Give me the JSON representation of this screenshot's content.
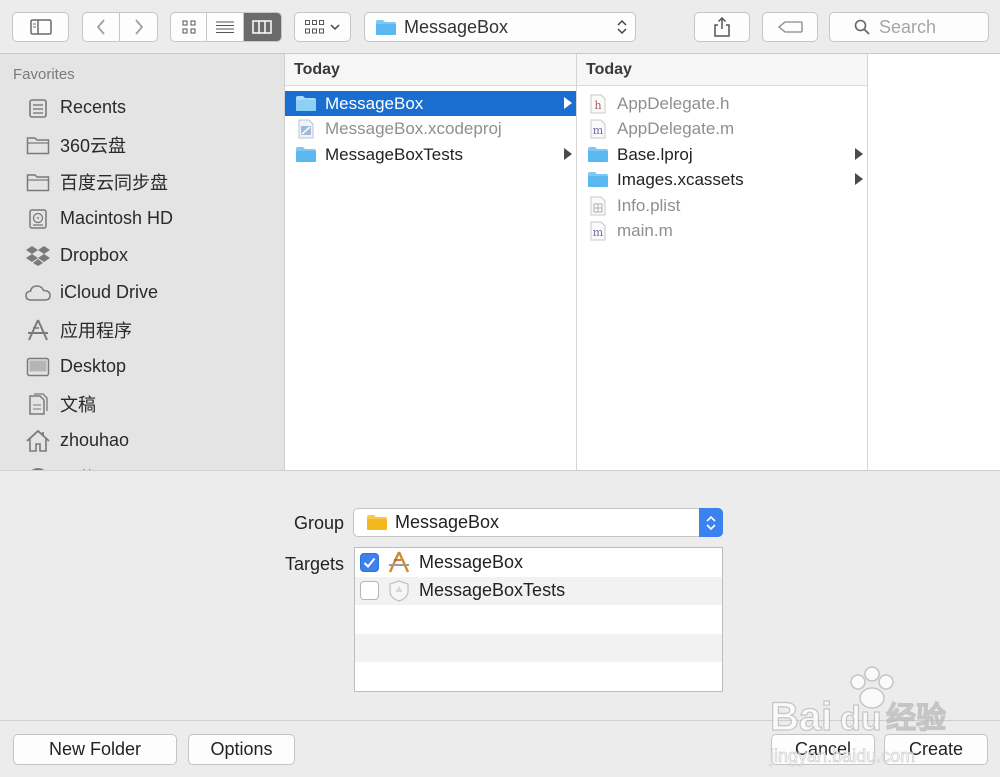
{
  "toolbar": {
    "location_label": "MessageBox",
    "search_placeholder": "Search"
  },
  "sidebar": {
    "heading": "Favorites",
    "items": [
      {
        "label": "Recents",
        "icon": "recents-icon"
      },
      {
        "label": "360云盘",
        "icon": "folder-icon"
      },
      {
        "label": "百度云同步盘",
        "icon": "folder-icon"
      },
      {
        "label": "Macintosh HD",
        "icon": "hard-drive-icon"
      },
      {
        "label": "Dropbox",
        "icon": "dropbox-icon"
      },
      {
        "label": "iCloud Drive",
        "icon": "cloud-icon"
      },
      {
        "label": "应用程序",
        "icon": "applications-icon"
      },
      {
        "label": "Desktop",
        "icon": "desktop-icon"
      },
      {
        "label": "文稿",
        "icon": "documents-icon"
      },
      {
        "label": "zhouhao",
        "icon": "home-icon"
      },
      {
        "label": "下载",
        "icon": "downloads-icon"
      }
    ]
  },
  "columns": [
    {
      "header": "Today",
      "items": [
        {
          "name": "MessageBox",
          "icon": "folder-icon",
          "selected": true,
          "has_children": true,
          "dimmed": false
        },
        {
          "name": "MessageBox.xcodeproj",
          "icon": "xcodeproj-icon",
          "selected": false,
          "has_children": false,
          "dimmed": true
        },
        {
          "name": "MessageBoxTests",
          "icon": "folder-icon",
          "selected": false,
          "has_children": true,
          "dimmed": false
        }
      ]
    },
    {
      "header": "Today",
      "items": [
        {
          "name": "AppDelegate.h",
          "icon": "header-file-icon",
          "selected": false,
          "has_children": false,
          "dimmed": true
        },
        {
          "name": "AppDelegate.m",
          "icon": "m-file-icon",
          "selected": false,
          "has_children": false,
          "dimmed": true
        },
        {
          "name": "Base.lproj",
          "icon": "folder-icon",
          "selected": false,
          "has_children": true,
          "dimmed": false
        },
        {
          "name": "Images.xcassets",
          "icon": "folder-icon",
          "selected": false,
          "has_children": true,
          "dimmed": false
        },
        {
          "name": "Info.plist",
          "icon": "plist-file-icon",
          "selected": false,
          "has_children": false,
          "dimmed": true
        },
        {
          "name": "main.m",
          "icon": "m-file-icon",
          "selected": false,
          "has_children": false,
          "dimmed": true
        }
      ]
    }
  ],
  "options": {
    "group_label": "Group",
    "group_value": "MessageBox",
    "targets_label": "Targets",
    "targets": [
      {
        "name": "MessageBox",
        "checked": true,
        "icon": "app-target-icon"
      },
      {
        "name": "MessageBoxTests",
        "checked": false,
        "icon": "test-target-icon"
      }
    ]
  },
  "buttons": {
    "new_folder": "New Folder",
    "options": "Options",
    "cancel": "Cancel",
    "create": "Create"
  },
  "colors": {
    "selection": "#1a6ecf",
    "accent": "#3b82f0",
    "folder": "#7ec8f5"
  }
}
